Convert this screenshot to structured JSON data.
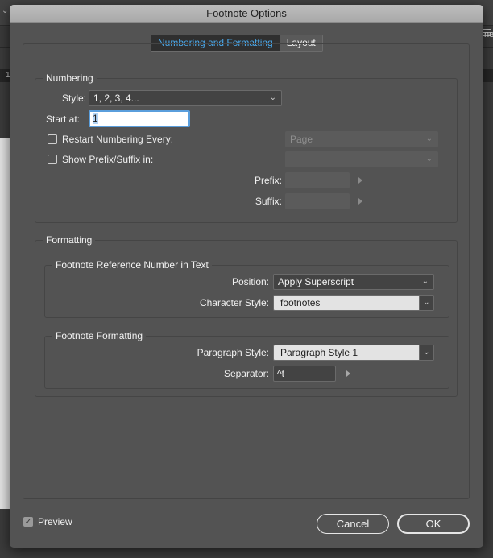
{
  "background": {
    "ruler_number": "1",
    "panel_label_fragment": "ne"
  },
  "dialog": {
    "title": "Footnote Options",
    "tabs": [
      {
        "label": "Numbering and Formatting",
        "active": true
      },
      {
        "label": "Layout",
        "active": false
      }
    ],
    "numbering": {
      "legend": "Numbering",
      "style_label": "Style:",
      "style_value": "1, 2, 3, 4...",
      "start_at_label": "Start at:",
      "start_at_value": "1",
      "restart_label": "Restart Numbering Every:",
      "restart_checked": false,
      "restart_value": "Page",
      "show_prefix_label": "Show Prefix/Suffix in:",
      "show_prefix_checked": false,
      "show_prefix_value": "",
      "prefix_label": "Prefix:",
      "prefix_value": "",
      "suffix_label": "Suffix:",
      "suffix_value": ""
    },
    "formatting": {
      "legend": "Formatting",
      "reference": {
        "legend": "Footnote Reference Number in Text",
        "position_label": "Position:",
        "position_value": "Apply Superscript",
        "char_style_label": "Character Style:",
        "char_style_value": "footnotes"
      },
      "footnote_formatting": {
        "legend": "Footnote Formatting",
        "para_style_label": "Paragraph Style:",
        "para_style_value": "Paragraph Style 1",
        "separator_label": "Separator:",
        "separator_value": "^t"
      }
    },
    "footer": {
      "preview_label": "Preview",
      "preview_checked": true,
      "cancel_label": "Cancel",
      "ok_label": "OK"
    }
  },
  "icons": {
    "chevron_down": "⌄",
    "checkmark": "✓"
  },
  "colors": {
    "accent": "#4aa8ea",
    "dialog_bg": "#535353",
    "focus_border": "#5a9edc"
  }
}
